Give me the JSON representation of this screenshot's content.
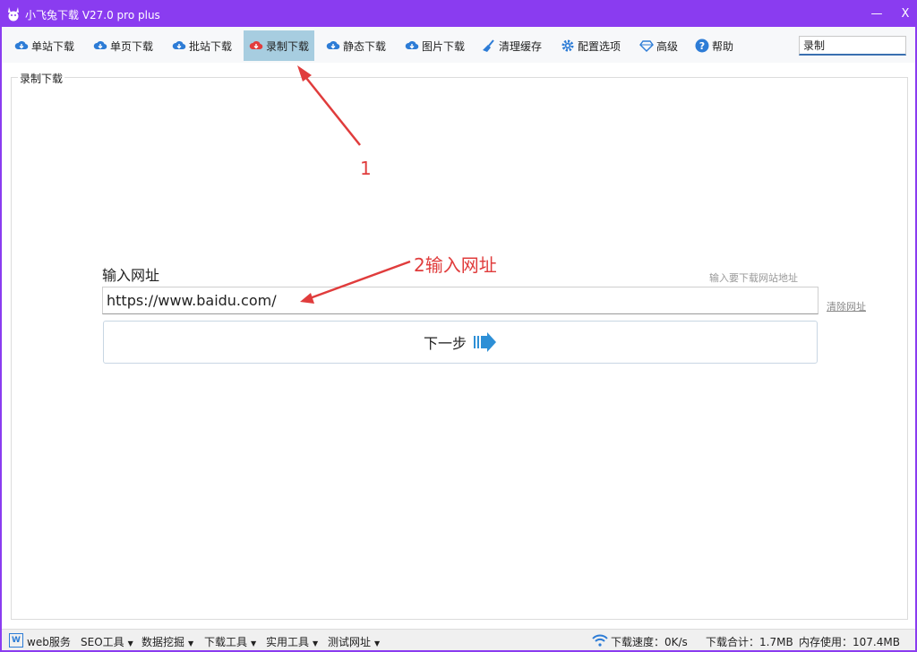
{
  "window": {
    "title": "小飞兔下载 V27.0 pro plus",
    "minimize_label": "—",
    "close_label": "X"
  },
  "toolbar": {
    "items": [
      {
        "label": "单站下载",
        "icon": "cloud-download-icon"
      },
      {
        "label": "单页下载",
        "icon": "cloud-download-icon"
      },
      {
        "label": "批站下载",
        "icon": "cloud-download-icon"
      },
      {
        "label": "录制下载",
        "icon": "cloud-download-red-icon",
        "active": true
      },
      {
        "label": "静态下载",
        "icon": "cloud-download-icon"
      },
      {
        "label": "图片下载",
        "icon": "cloud-download-icon"
      },
      {
        "label": "清理缓存",
        "icon": "broom-icon"
      },
      {
        "label": "配置选项",
        "icon": "gear-icon"
      },
      {
        "label": "高级",
        "icon": "diamond-icon"
      },
      {
        "label": "帮助",
        "icon": "help-icon"
      }
    ],
    "search_value": "录制"
  },
  "main": {
    "group_title": "录制下载",
    "url_label": "输入网址",
    "url_hint": "输入要下载网站地址",
    "url_value": "https://www.baidu.com/",
    "clear_label": "清除网址",
    "next_label": "下一步"
  },
  "annotations": {
    "step1": "1",
    "step2": "2输入网址",
    "color": "#e03c3c"
  },
  "statusbar": {
    "web_icon_text": "W",
    "menus": [
      "web服务",
      "SEO工具",
      "数据挖掘",
      "下载工具",
      "实用工具",
      "测试网址"
    ],
    "download_speed": "下载速度：0K/s",
    "download_total": "下载合计：1.7MB",
    "memory_usage": "内存使用：107.4MB"
  },
  "colors": {
    "titlebar": "#8a3cf0",
    "toolbar_active": "#a7cde0",
    "accent_blue": "#2d7cd6"
  }
}
